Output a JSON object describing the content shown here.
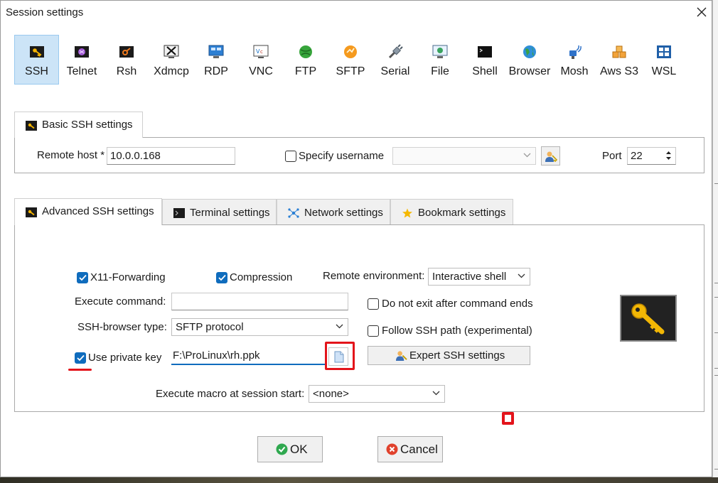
{
  "window": {
    "title": "Session settings"
  },
  "protocols": [
    {
      "label": "SSH",
      "icon": "ssh-key-icon",
      "selected": true
    },
    {
      "label": "Telnet",
      "icon": "telnet-icon"
    },
    {
      "label": "Rsh",
      "icon": "rsh-icon"
    },
    {
      "label": "Xdmcp",
      "icon": "xdmcp-icon"
    },
    {
      "label": "RDP",
      "icon": "rdp-monitor-icon"
    },
    {
      "label": "VNC",
      "icon": "vnc-icon"
    },
    {
      "label": "FTP",
      "icon": "ftp-globe-icon"
    },
    {
      "label": "SFTP",
      "icon": "sftp-icon"
    },
    {
      "label": "Serial",
      "icon": "serial-plug-icon"
    },
    {
      "label": "File",
      "icon": "file-monitor-icon"
    },
    {
      "label": "Shell",
      "icon": "shell-terminal-icon"
    },
    {
      "label": "Browser",
      "icon": "browser-globe-icon"
    },
    {
      "label": "Mosh",
      "icon": "mosh-satellite-icon"
    },
    {
      "label": "Aws S3",
      "icon": "aws-s3-icon"
    },
    {
      "label": "WSL",
      "icon": "wsl-windows-icon"
    }
  ],
  "basic": {
    "tab_label": "Basic SSH settings",
    "remote_host_label": "Remote host *",
    "remote_host_value": "10.0.0.168",
    "specify_username_label": "Specify username",
    "username_value": "",
    "port_label": "Port",
    "port_value": "22"
  },
  "advanced_tabs": [
    {
      "label": "Advanced SSH settings",
      "active": true
    },
    {
      "label": "Terminal settings"
    },
    {
      "label": "Network settings"
    },
    {
      "label": "Bookmark settings"
    }
  ],
  "advanced": {
    "x11_label": "X11-Forwarding",
    "compression_label": "Compression",
    "remote_env_label": "Remote environment:",
    "remote_env_value": "Interactive shell",
    "execute_command_label": "Execute command:",
    "execute_command_value": "",
    "do_not_exit_label": "Do not exit after command ends",
    "ssh_browser_label": "SSH-browser type:",
    "ssh_browser_value": "SFTP protocol",
    "follow_path_label": "Follow SSH path (experimental)",
    "private_key_label": "Use private key",
    "private_key_value": "F:\\ProLinux\\rh.ppk",
    "expert_label": "Expert SSH settings",
    "macro_label": "Execute macro at session start:",
    "macro_value": "<none>"
  },
  "footer": {
    "ok_label": "OK",
    "cancel_label": "Cancel"
  },
  "colors": {
    "accent": "#0f6cbd",
    "annotation": "#e3141b",
    "selected_bg": "#cce4f7"
  }
}
